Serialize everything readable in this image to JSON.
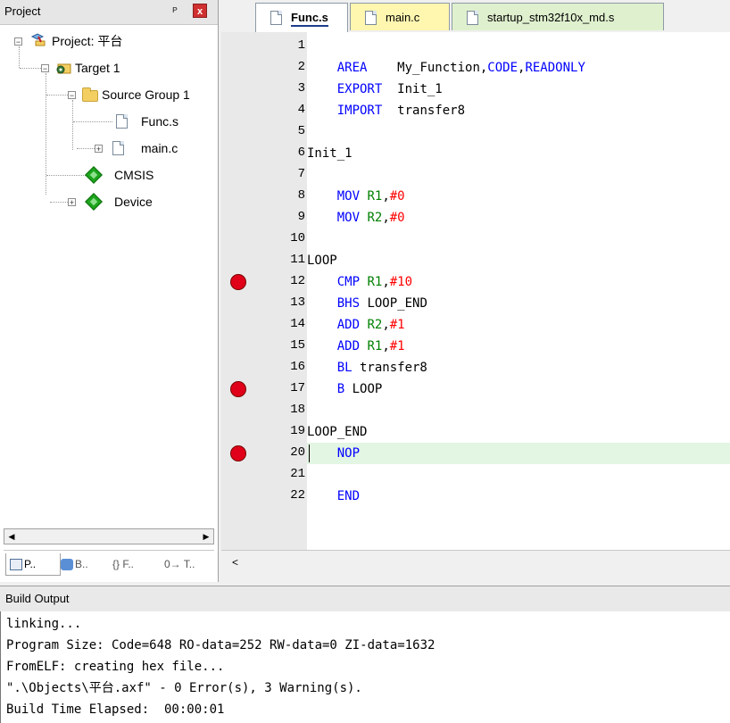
{
  "project_panel": {
    "title": "Project",
    "pin_glyph": "ᴘ",
    "close_glyph": "x",
    "tree": [
      {
        "label": "Project: 平台",
        "icon": "project-icon",
        "expander": "−"
      },
      {
        "label": "Target 1",
        "icon": "target-icon",
        "expander": "−"
      },
      {
        "label": "Source Group 1",
        "icon": "folder-icon",
        "expander": "−"
      },
      {
        "label": "Func.s",
        "icon": "file-icon",
        "expander": ""
      },
      {
        "label": "main.c",
        "icon": "file-icon",
        "expander": "+"
      },
      {
        "label": "CMSIS",
        "icon": "component-icon",
        "expander": ""
      },
      {
        "label": "Device",
        "icon": "component-icon",
        "expander": "+"
      }
    ],
    "bottom_tabs": [
      {
        "label": "P..",
        "icon": "project-tab-icon"
      },
      {
        "label": "B..",
        "icon": "books-tab-icon"
      },
      {
        "label": "{} F..",
        "icon": "functions-tab-icon"
      },
      {
        "label": "0→ T..",
        "icon": "templates-tab-icon"
      }
    ]
  },
  "editor": {
    "tabs": [
      {
        "label": "Func.s",
        "color": "#ffffff",
        "active": true
      },
      {
        "label": "main.c",
        "color": "#fff6b0",
        "active": false
      },
      {
        "label": "startup_stm32f10x_md.s",
        "color": "#dff0ce",
        "active": false
      }
    ],
    "breakpoint_color": "#e0001a",
    "current_line_color": "#e3f5e3",
    "lines": [
      {
        "n": "1",
        "bp": false,
        "tokens": []
      },
      {
        "n": "2",
        "bp": false,
        "tokens": [
          {
            "t": "    ",
            "c": "txt"
          },
          {
            "t": "AREA",
            "c": "kw"
          },
          {
            "t": "    My_Function,",
            "c": "txt"
          },
          {
            "t": "CODE",
            "c": "kw"
          },
          {
            "t": ",",
            "c": "txt"
          },
          {
            "t": "READONLY",
            "c": "kw"
          }
        ]
      },
      {
        "n": "3",
        "bp": false,
        "tokens": [
          {
            "t": "    ",
            "c": "txt"
          },
          {
            "t": "EXPORT",
            "c": "kw"
          },
          {
            "t": "  Init_1",
            "c": "txt"
          }
        ]
      },
      {
        "n": "4",
        "bp": false,
        "tokens": [
          {
            "t": "    ",
            "c": "txt"
          },
          {
            "t": "IMPORT",
            "c": "kw"
          },
          {
            "t": "  transfer8",
            "c": "txt"
          }
        ]
      },
      {
        "n": "5",
        "bp": false,
        "tokens": []
      },
      {
        "n": "6",
        "bp": false,
        "tokens": [
          {
            "t": "Init_1",
            "c": "txt"
          }
        ]
      },
      {
        "n": "7",
        "bp": false,
        "tokens": []
      },
      {
        "n": "8",
        "bp": false,
        "tokens": [
          {
            "t": "    ",
            "c": "txt"
          },
          {
            "t": "MOV",
            "c": "kw"
          },
          {
            "t": " ",
            "c": "txt"
          },
          {
            "t": "R1",
            "c": "reg"
          },
          {
            "t": ",",
            "c": "txt"
          },
          {
            "t": "#0",
            "c": "num"
          }
        ]
      },
      {
        "n": "9",
        "bp": false,
        "tokens": [
          {
            "t": "    ",
            "c": "txt"
          },
          {
            "t": "MOV",
            "c": "kw"
          },
          {
            "t": " ",
            "c": "txt"
          },
          {
            "t": "R2",
            "c": "reg"
          },
          {
            "t": ",",
            "c": "txt"
          },
          {
            "t": "#0",
            "c": "num"
          }
        ]
      },
      {
        "n": "10",
        "bp": false,
        "tokens": []
      },
      {
        "n": "11",
        "bp": false,
        "tokens": [
          {
            "t": "LOOP",
            "c": "txt"
          }
        ]
      },
      {
        "n": "12",
        "bp": true,
        "tokens": [
          {
            "t": "    ",
            "c": "txt"
          },
          {
            "t": "CMP",
            "c": "kw"
          },
          {
            "t": " ",
            "c": "txt"
          },
          {
            "t": "R1",
            "c": "reg"
          },
          {
            "t": ",",
            "c": "txt"
          },
          {
            "t": "#10",
            "c": "num"
          }
        ]
      },
      {
        "n": "13",
        "bp": false,
        "tokens": [
          {
            "t": "    ",
            "c": "txt"
          },
          {
            "t": "BHS",
            "c": "kw"
          },
          {
            "t": " LOOP_END",
            "c": "txt"
          }
        ]
      },
      {
        "n": "14",
        "bp": false,
        "tokens": [
          {
            "t": "    ",
            "c": "txt"
          },
          {
            "t": "ADD",
            "c": "kw"
          },
          {
            "t": " ",
            "c": "txt"
          },
          {
            "t": "R2",
            "c": "reg"
          },
          {
            "t": ",",
            "c": "txt"
          },
          {
            "t": "#1",
            "c": "num"
          }
        ]
      },
      {
        "n": "15",
        "bp": false,
        "tokens": [
          {
            "t": "    ",
            "c": "txt"
          },
          {
            "t": "ADD",
            "c": "kw"
          },
          {
            "t": " ",
            "c": "txt"
          },
          {
            "t": "R1",
            "c": "reg"
          },
          {
            "t": ",",
            "c": "txt"
          },
          {
            "t": "#1",
            "c": "num"
          }
        ]
      },
      {
        "n": "16",
        "bp": false,
        "tokens": [
          {
            "t": "    ",
            "c": "txt"
          },
          {
            "t": "BL",
            "c": "kw"
          },
          {
            "t": " transfer8",
            "c": "txt"
          }
        ]
      },
      {
        "n": "17",
        "bp": true,
        "tokens": [
          {
            "t": "    ",
            "c": "txt"
          },
          {
            "t": "B",
            "c": "kw"
          },
          {
            "t": " LOOP",
            "c": "txt"
          }
        ]
      },
      {
        "n": "18",
        "bp": false,
        "tokens": []
      },
      {
        "n": "19",
        "bp": false,
        "tokens": [
          {
            "t": "LOOP_END",
            "c": "txt"
          }
        ]
      },
      {
        "n": "20",
        "bp": true,
        "current": true,
        "tokens": [
          {
            "t": "    ",
            "c": "txt"
          },
          {
            "t": "NOP",
            "c": "kw"
          }
        ]
      },
      {
        "n": "21",
        "bp": false,
        "tokens": []
      },
      {
        "n": "22",
        "bp": false,
        "tokens": [
          {
            "t": "    ",
            "c": "txt"
          },
          {
            "t": "END",
            "c": "kw"
          }
        ]
      }
    ]
  },
  "build_output": {
    "title": "Build Output",
    "lines": [
      "linking...",
      "Program Size: Code=648 RO-data=252 RW-data=0 ZI-data=1632",
      "FromELF: creating hex file...",
      "\".\\Objects\\平台.axf\" - 0 Error(s), 3 Warning(s).",
      "Build Time Elapsed:  00:00:01"
    ]
  }
}
